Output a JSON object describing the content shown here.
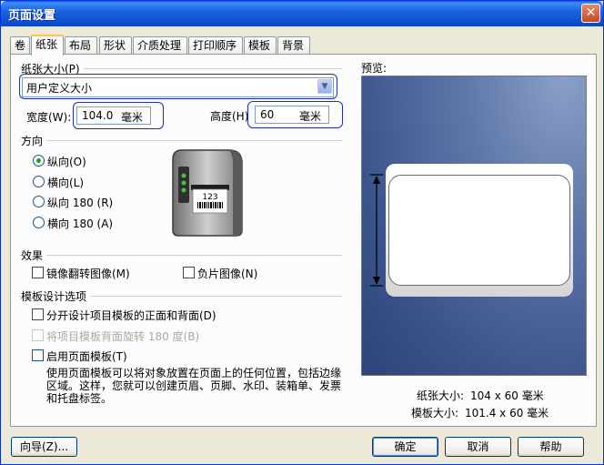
{
  "window": {
    "title": "页面设置",
    "close_glyph": "✕"
  },
  "tabs": [
    {
      "label": "卷"
    },
    {
      "label": "纸张"
    },
    {
      "label": "布局"
    },
    {
      "label": "形状"
    },
    {
      "label": "介质处理"
    },
    {
      "label": "打印顺序"
    },
    {
      "label": "模板"
    },
    {
      "label": "背景"
    }
  ],
  "paper_size": {
    "group_label": "纸张大小(P)",
    "selected": "用户定义大小",
    "width_label": "宽度(W):",
    "width_value": "104.0",
    "width_unit": "毫米",
    "height_label": "高度(H)",
    "height_value": "60",
    "height_unit": "毫米"
  },
  "orientation": {
    "group_label": "方向",
    "options": [
      {
        "label": "纵向(O)",
        "checked": true
      },
      {
        "label": "横向(L)",
        "checked": false
      },
      {
        "label": "纵向 180 (R)",
        "checked": false
      },
      {
        "label": "横向 180 (A)",
        "checked": false
      }
    ],
    "printer_label_text": "123"
  },
  "effects": {
    "group_label": "效果",
    "mirror": "镜像翻转图像(M)",
    "negative": "负片图像(N)"
  },
  "template_options": {
    "group_label": "模板设计选项",
    "separate": "分开设计项目模板的正面和背面(D)",
    "rotate": "将项目模板背面旋转 180 度(B)",
    "enable": "启用页面模板(T)",
    "description": "使用页面模板可以将对象放置在页面上的任何位置，包括边缘区域。这样，您就可以创建页眉、页脚、水印、装箱单、发票和托盘标签。"
  },
  "preview": {
    "label": "预览:",
    "paper_size_label": "纸张大小:",
    "paper_size_value": "104 x 60 毫米",
    "template_size_label": "模板大小:",
    "template_size_value": "101.4 x 60 毫米"
  },
  "buttons": {
    "wizard": "向导(Z)...",
    "ok": "确定",
    "cancel": "取消",
    "help": "帮助"
  },
  "colors": {
    "title_bar": "#0a50d0",
    "highlight_ring": "#1f2dac",
    "preview_bg": "#3a538a"
  }
}
